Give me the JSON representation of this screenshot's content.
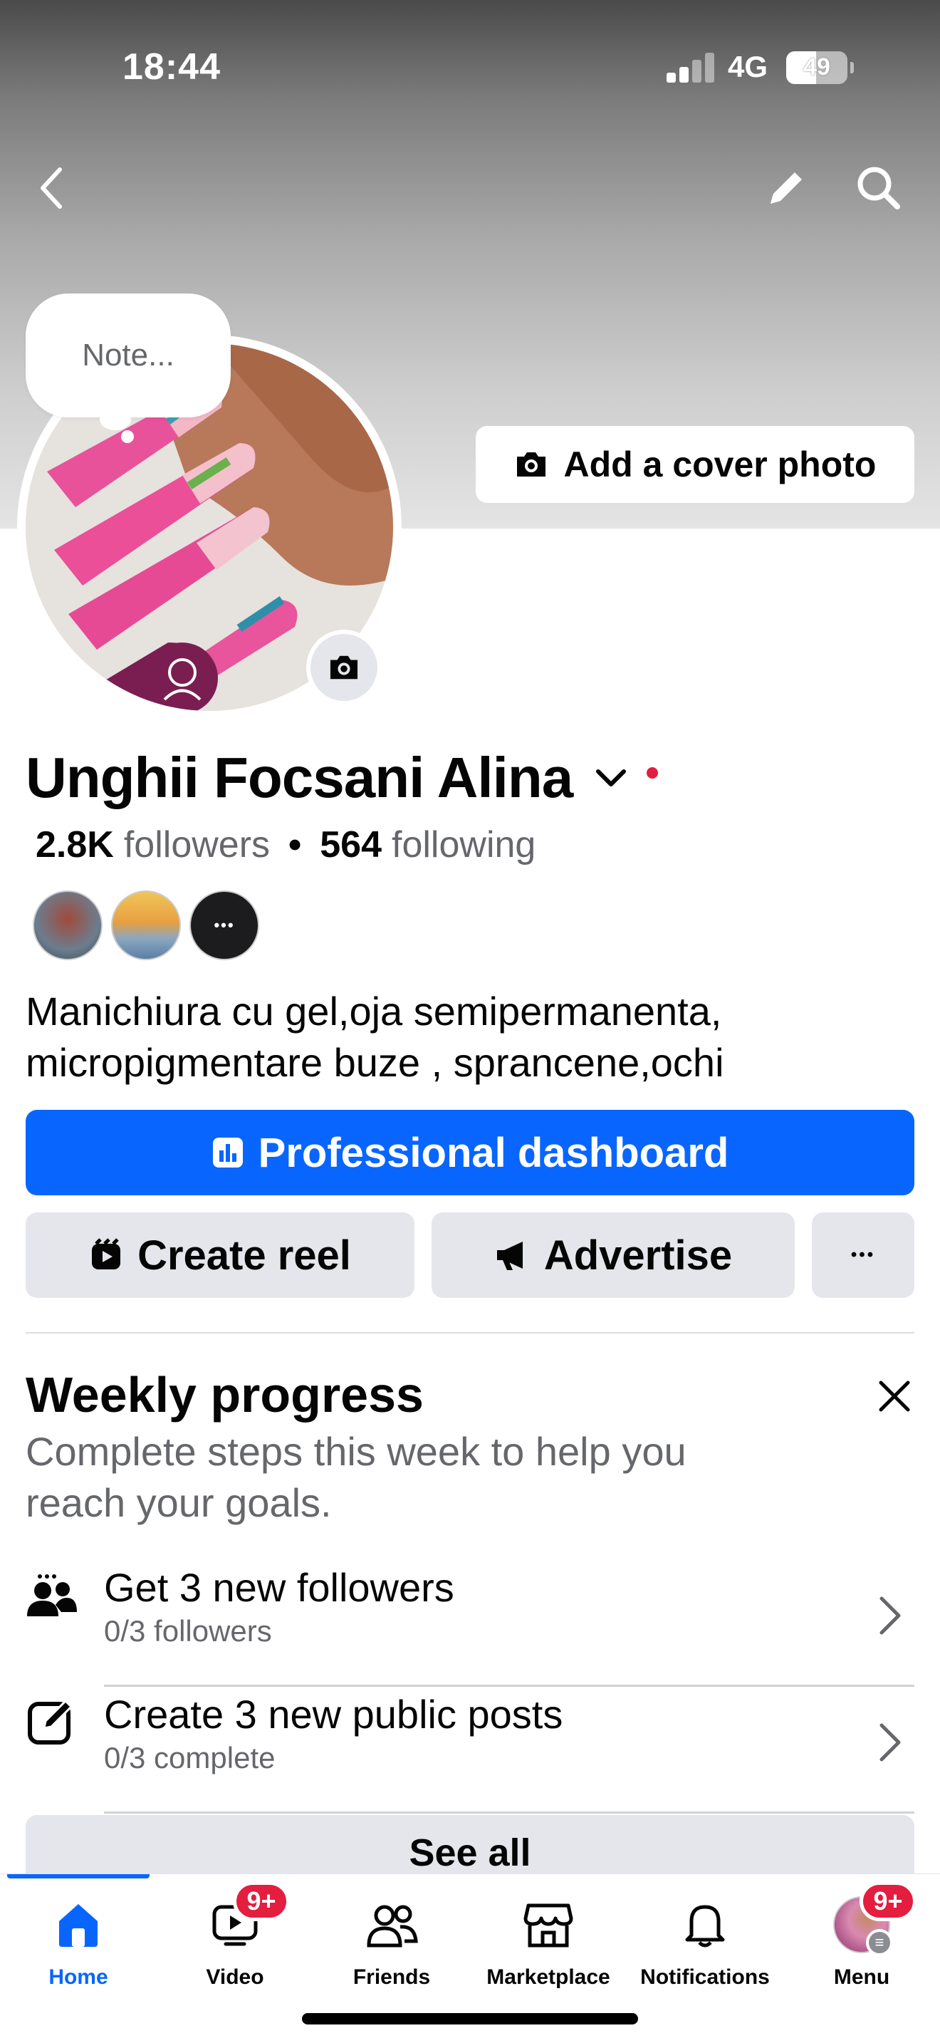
{
  "status": {
    "time": "18:44",
    "network": "4G",
    "battery": "49",
    "battery_level": 0.49
  },
  "cover": {
    "add_cover_label": "Add a cover photo"
  },
  "note": {
    "placeholder": "Note..."
  },
  "profile": {
    "name": "Unghii Focsani Alina",
    "followers_count": "2.8K",
    "followers_label": "followers",
    "separator": "•",
    "following_count": "564",
    "following_label": "following",
    "friend_more": "•••",
    "bio_line1": "Manichiura cu gel,oja semipermanenta,",
    "bio_line2": "micropigmentare buze , sprancene,ochi"
  },
  "actions": {
    "professional_dashboard": "Professional dashboard",
    "create_reel": "Create reel",
    "advertise": "Advertise",
    "more": "•••"
  },
  "weekly_progress": {
    "title": "Weekly progress",
    "subtitle_line1": "Complete steps this week to help you",
    "subtitle_line2": "reach your goals.",
    "tasks": [
      {
        "title": "Get 3 new followers",
        "sub": "0/3 followers",
        "icon": "people-icon"
      },
      {
        "title": "Create 3 new public posts",
        "sub": "0/3 complete",
        "icon": "compose-icon"
      }
    ],
    "see_all": "See all"
  },
  "tabs": [
    {
      "label": "Home",
      "icon": "home-icon",
      "active": true
    },
    {
      "label": "Video",
      "icon": "video-icon",
      "badge": "9+"
    },
    {
      "label": "Friends",
      "icon": "friends-icon"
    },
    {
      "label": "Marketplace",
      "icon": "marketplace-icon"
    },
    {
      "label": "Notifications",
      "icon": "bell-icon"
    },
    {
      "label": "Menu",
      "icon": "profile-avatar",
      "badge": "9+"
    }
  ],
  "colors": {
    "accent": "#0866ff",
    "badge": "#e41e3f",
    "secondary_bg": "#e4e6eb",
    "muted_text": "#65676b"
  }
}
